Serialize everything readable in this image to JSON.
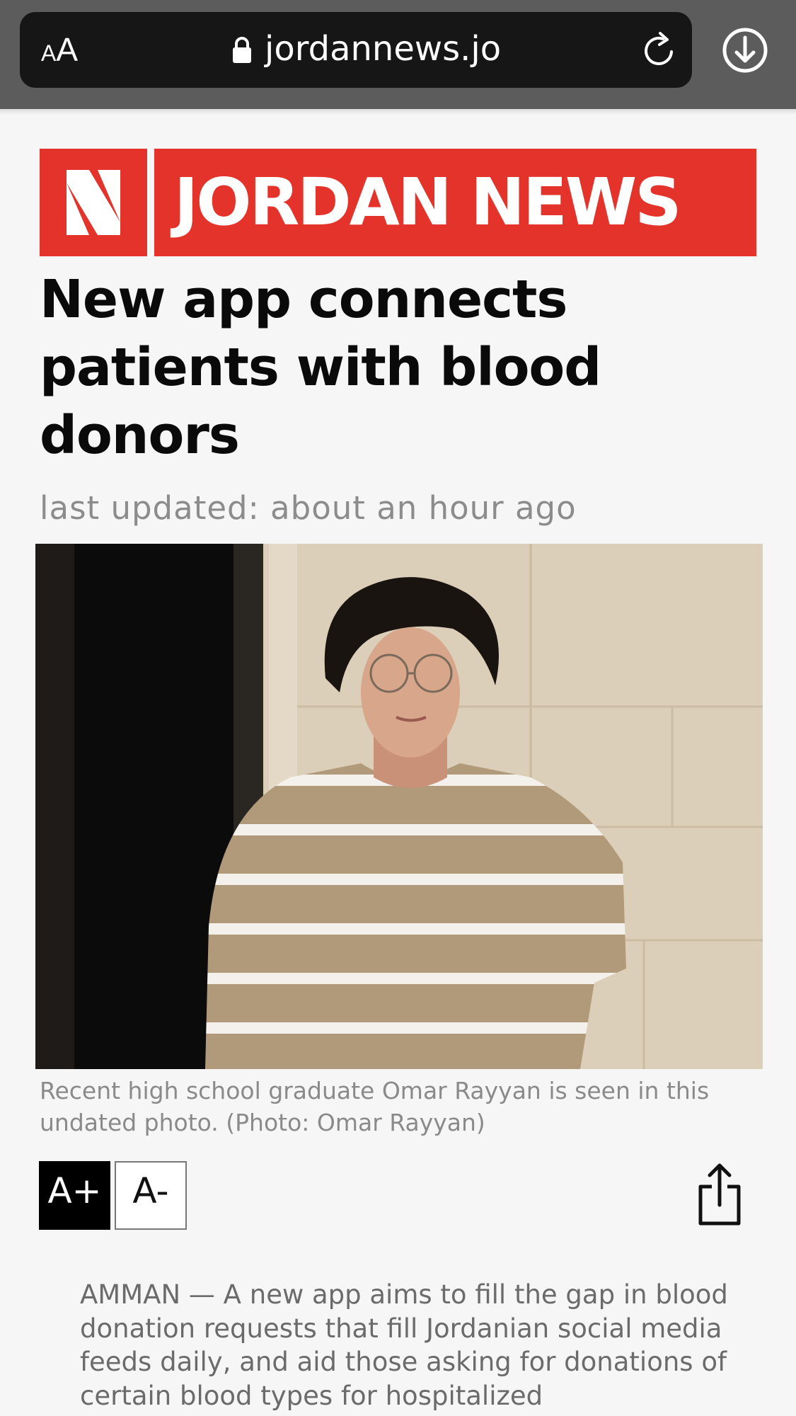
{
  "browser": {
    "text_size_label_small": "A",
    "text_size_label_big": "A",
    "url": "jordannews.jo"
  },
  "site": {
    "logo_text": "JORDAN NEWS",
    "brand_color": "#e3332a"
  },
  "article": {
    "headline": "New app connects patients with blood donors",
    "last_updated": "last updated: about an hour ago",
    "photo_caption": "Recent high school graduate Omar Rayyan is seen in this undated photo. (Photo: Omar Rayyan)",
    "body": "AMMAN — A new app  aims to fill the gap in blood donation requests that fill Jordanian social media feeds daily, and aid those asking for donations of certain blood types for hospitalized"
  },
  "tools": {
    "increase_font_label": "A+",
    "decrease_font_label": "A-"
  },
  "icons": {
    "lock": "lock-icon",
    "reload": "reload-icon",
    "download": "download-icon",
    "share": "share-icon"
  }
}
